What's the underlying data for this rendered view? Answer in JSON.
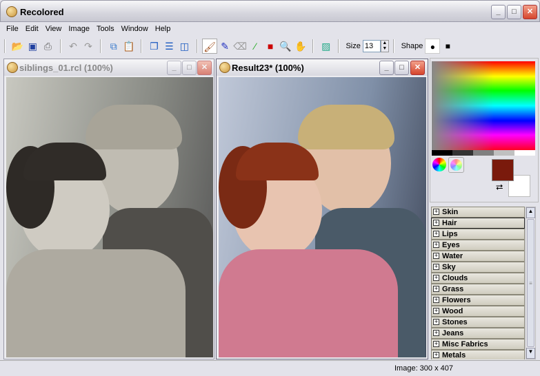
{
  "app": {
    "title": "Recolored"
  },
  "menu": [
    "File",
    "Edit",
    "View",
    "Image",
    "Tools",
    "Window",
    "Help"
  ],
  "toolbar": {
    "size_label": "Size",
    "size_value": "13",
    "shape_label": "Shape"
  },
  "windows": [
    {
      "title": "siblings_01.rcl (100%)"
    },
    {
      "title": "Result23* (100%)"
    }
  ],
  "colors": {
    "foreground": "#7a1a0c",
    "background": "#ffffff"
  },
  "categories": [
    "Skin",
    "Hair",
    "Lips",
    "Eyes",
    "Water",
    "Sky",
    "Clouds",
    "Grass",
    "Flowers",
    "Wood",
    "Stones",
    "Jeans",
    "Misc Fabrics",
    "Metals"
  ],
  "selected_category": "Hair",
  "status": {
    "image_size": "Image: 300 x 407"
  }
}
